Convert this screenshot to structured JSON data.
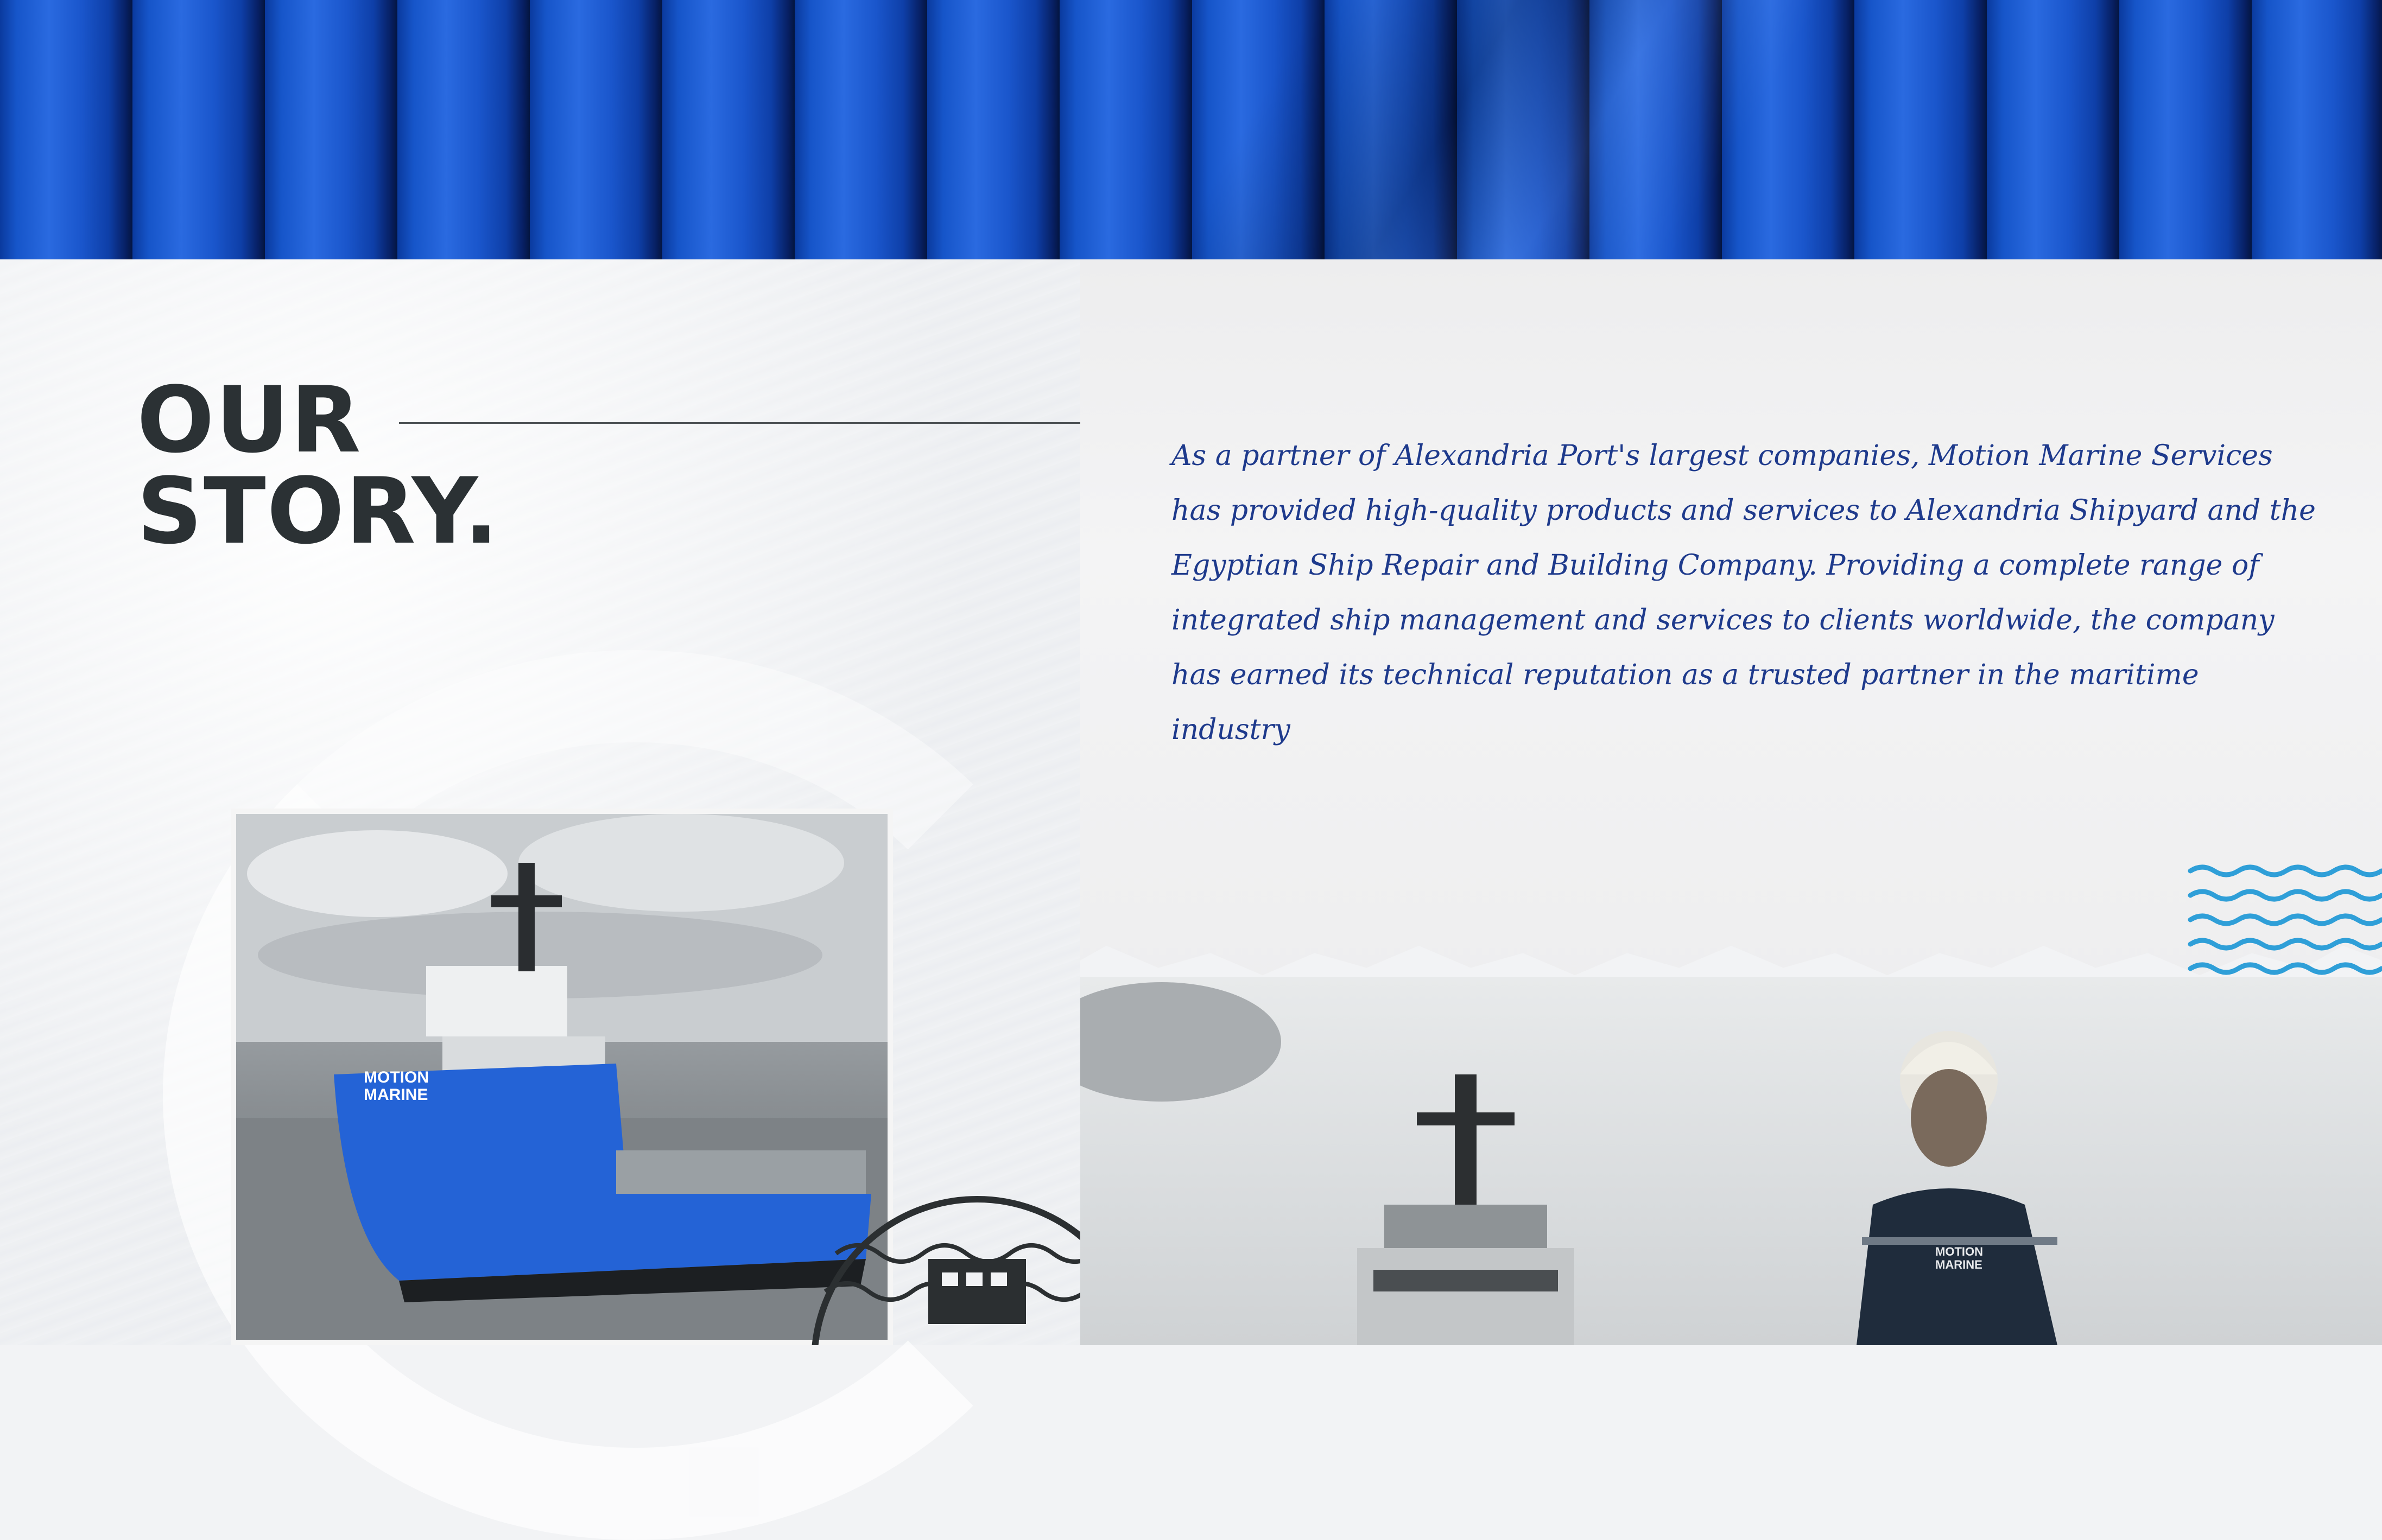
{
  "banner": {
    "color": "#1a56cc"
  },
  "heading": {
    "line1": "OUR",
    "line2": "STORY."
  },
  "story": {
    "text": " As a partner of Alexandria Port's largest companies, Motion Marine Services has provided high-quality products and services to Alexandria Shipyard and the Egyptian Ship Repair and Building Company. Providing a complete range of integrated ship management and services to clients worldwide, the company has earned its technical reputation as a trusted partner in the maritime industry"
  },
  "ship_photo": {
    "hull_logo": "MOTION MARINE"
  },
  "crew_photo": {
    "uniform_logo": "MOTION MARINE"
  },
  "colors": {
    "heading": "#2b3134",
    "story_text": "#1e3a8c",
    "waves": "#2f9fd8",
    "hull": "#2463d6"
  }
}
